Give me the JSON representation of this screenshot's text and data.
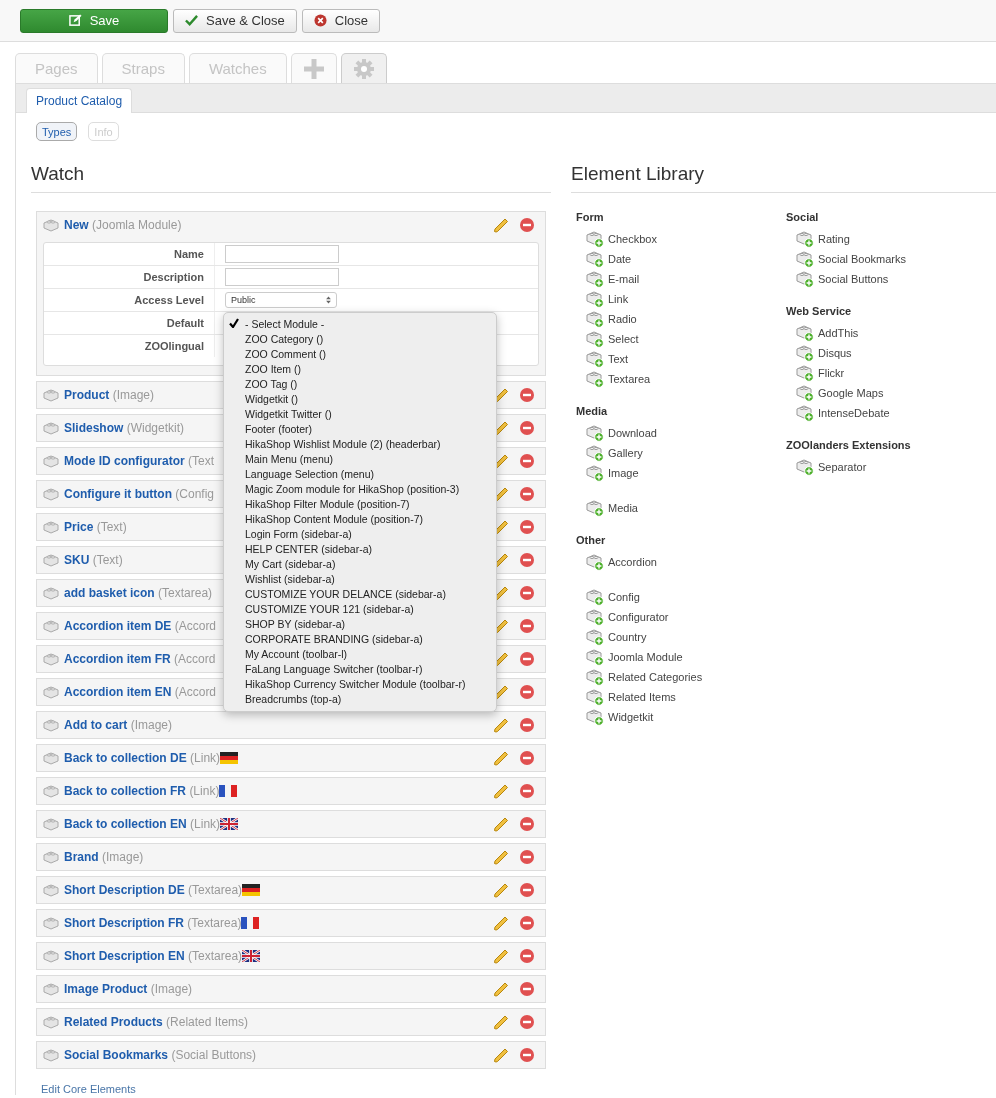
{
  "toolbar": [
    {
      "label": "Save",
      "kind": "save"
    },
    {
      "label": "Save & Close",
      "kind": "check"
    },
    {
      "label": "Close",
      "kind": "close"
    }
  ],
  "tabs": [
    {
      "label": "Pages",
      "kind": "text",
      "selected": false
    },
    {
      "label": "Straps",
      "kind": "text",
      "selected": false
    },
    {
      "label": "Watches",
      "kind": "text",
      "selected": false
    },
    {
      "kind": "plus",
      "selected": false
    },
    {
      "kind": "gear",
      "selected": true
    }
  ],
  "subtabs": [
    {
      "label": "Product Catalog",
      "selected": true
    }
  ],
  "pills": [
    {
      "label": "Types",
      "selected": true
    },
    {
      "label": "Info",
      "selected": false
    }
  ],
  "watch": {
    "title": "Watch",
    "expanded": {
      "name": "New",
      "type": "(Joomla Module)",
      "fields": [
        {
          "label": "Name",
          "kind": "input"
        },
        {
          "label": "Description",
          "kind": "input"
        },
        {
          "label": "Access Level",
          "kind": "select",
          "value": "Public"
        },
        {
          "label": "Default",
          "kind": "dropdown"
        },
        {
          "label": "ZOOlingual",
          "kind": "none"
        }
      ],
      "dropdown": [
        {
          "label": "- Select Module -",
          "selected": true
        },
        {
          "label": "ZOO Category ()",
          "selected": false
        },
        {
          "label": "ZOO Comment ()",
          "selected": false
        },
        {
          "label": "ZOO Item ()",
          "selected": false
        },
        {
          "label": "ZOO Tag ()",
          "selected": false
        },
        {
          "label": "Widgetkit ()",
          "selected": false
        },
        {
          "label": "Widgetkit Twitter ()",
          "selected": false
        },
        {
          "label": "Footer (footer)",
          "selected": false
        },
        {
          "label": "HikaShop Wishlist Module (2) (headerbar)",
          "selected": false
        },
        {
          "label": "Main Menu (menu)",
          "selected": false
        },
        {
          "label": "Language Selection (menu)",
          "selected": false
        },
        {
          "label": "Magic Zoom module for HikaShop (position-3)",
          "selected": false
        },
        {
          "label": "HikaShop Filter Module (position-7)",
          "selected": false
        },
        {
          "label": "HikaShop Content Module (position-7)",
          "selected": false
        },
        {
          "label": "Login Form (sidebar-a)",
          "selected": false
        },
        {
          "label": "HELP CENTER (sidebar-a)",
          "selected": false
        },
        {
          "label": "My Cart (sidebar-a)",
          "selected": false
        },
        {
          "label": "Wishlist (sidebar-a)",
          "selected": false
        },
        {
          "label": "CUSTOMIZE YOUR DELANCE (sidebar-a)",
          "selected": false
        },
        {
          "label": "CUSTOMIZE YOUR 121 (sidebar-a)",
          "selected": false
        },
        {
          "label": "SHOP BY (sidebar-a)",
          "selected": false
        },
        {
          "label": "CORPORATE BRANDING (sidebar-a)",
          "selected": false
        },
        {
          "label": "My Account (toolbar-l)",
          "selected": false
        },
        {
          "label": "FaLang Language Switcher (toolbar-r)",
          "selected": false
        },
        {
          "label": "HikaShop Currency Switcher Module (toolbar-r)",
          "selected": false
        },
        {
          "label": "Breadcrumbs (top-a)",
          "selected": false
        }
      ]
    },
    "rows": [
      {
        "name": "Product",
        "type": "(Image)"
      },
      {
        "name": "Slideshow",
        "type": "(Widgetkit)"
      },
      {
        "name": "Mode ID configurator",
        "type": "(Text"
      },
      {
        "name": "Configure it button",
        "type": "(Config"
      },
      {
        "name": "Price",
        "type": "(Text)"
      },
      {
        "name": "SKU",
        "type": "(Text)"
      },
      {
        "name": "add basket icon",
        "type": "(Textarea)"
      },
      {
        "name": "Accordion item DE",
        "type": "(Accord"
      },
      {
        "name": "Accordion item FR",
        "type": "(Accord"
      },
      {
        "name": "Accordion item EN",
        "type": "(Accord"
      },
      {
        "name": "Add to cart",
        "type": "(Image)"
      },
      {
        "name": "Back to collection DE",
        "type": "(Link)",
        "kind": "de"
      },
      {
        "name": "Back to collection FR",
        "type": "(Link)",
        "kind": "fr"
      },
      {
        "name": "Back to collection EN",
        "type": "(Link)",
        "kind": "gb"
      },
      {
        "name": "Brand",
        "type": "(Image)"
      },
      {
        "name": "Short Description DE",
        "type": "(Textarea)",
        "kind": "de"
      },
      {
        "name": "Short Description FR",
        "type": "(Textarea)",
        "kind": "fr"
      },
      {
        "name": "Short Description EN",
        "type": "(Textarea)",
        "kind": "gb"
      },
      {
        "name": "Image Product",
        "type": "(Image)"
      },
      {
        "name": "Related Products",
        "type": "(Related Items)"
      },
      {
        "name": "Social Bookmarks",
        "type": "(Social Buttons)"
      }
    ],
    "footer_link": "Edit Core Elements"
  },
  "library": {
    "title": "Element Library",
    "columns": [
      [
        {
          "title": "Form",
          "sets": [
            [
              "Checkbox",
              "Date",
              "E-mail",
              "Link",
              "Radio",
              "Select",
              "Text",
              "Textarea"
            ]
          ]
        },
        {
          "title": "Media",
          "sets": [
            [
              "Download",
              "Gallery",
              "Image"
            ],
            [
              "Media"
            ]
          ]
        },
        {
          "title": "Other",
          "sets": [
            [
              "Accordion"
            ],
            [
              "Config",
              "Configurator",
              "Country",
              "Joomla Module",
              "Related Categories",
              "Related Items",
              "Widgetkit"
            ]
          ]
        }
      ],
      [
        {
          "title": "Social",
          "sets": [
            [
              "Rating",
              "Social Bookmarks",
              "Social Buttons"
            ]
          ]
        },
        {
          "title": "Web Service",
          "sets": [
            [
              "AddThis",
              "Disqus",
              "Flickr",
              "Google Maps",
              "IntenseDebate"
            ]
          ]
        },
        {
          "title": "ZOOlanders Extensions",
          "sets": [
            [
              "Separator"
            ]
          ]
        }
      ]
    ]
  }
}
